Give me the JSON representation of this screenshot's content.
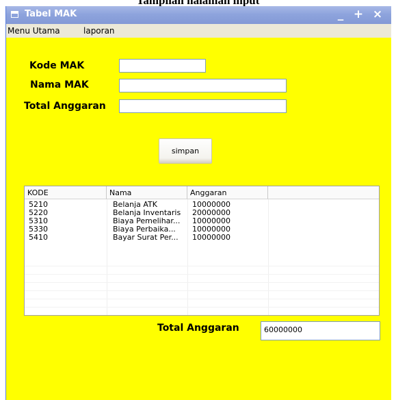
{
  "caption": "Tampilan halaman input",
  "window": {
    "title": "Tabel MAK",
    "buttons": {
      "minimize": "_",
      "maximize": "+",
      "close": "×"
    }
  },
  "menu": [
    "Menu Utama",
    "laporan"
  ],
  "form": {
    "kode_label": "Kode MAK",
    "nama_label": "Nama MAK",
    "total_label": "Total Anggaran",
    "kode_value": "",
    "nama_value": "",
    "total_value": ""
  },
  "save_button": "simpan",
  "table": {
    "columns": [
      "KODE",
      "Nama",
      "Anggaran",
      ""
    ],
    "rows": [
      [
        "5210",
        "Belanja ATK",
        "10000000"
      ],
      [
        "5220",
        "Belanja Inventaris",
        "20000000"
      ],
      [
        "5310",
        "Biaya Pemelihar...",
        "10000000"
      ],
      [
        "5330",
        "Biaya Perbaika...",
        "10000000"
      ],
      [
        "5410",
        "Bayar Surat Per...",
        "10000000"
      ]
    ]
  },
  "footer": {
    "total_label": "Total Anggaran",
    "total_value": "60000000"
  },
  "colors": {
    "form_background": "#ffff00",
    "titlebar": "#8ea4dd",
    "menubar": "#ece9d8"
  }
}
